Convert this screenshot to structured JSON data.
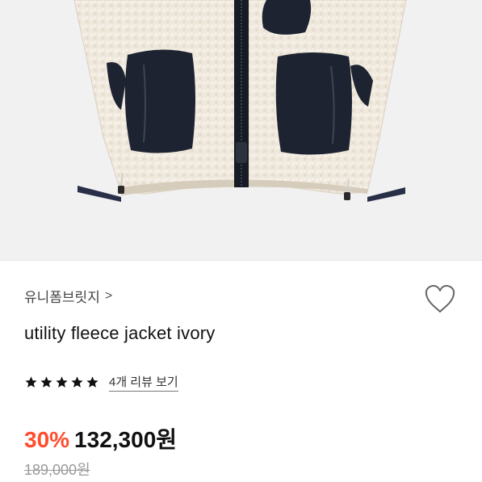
{
  "product": {
    "brand": "유니폼브릿지",
    "brand_chevron": ">",
    "title": "utility fleece jacket ivory",
    "rating_stars": 5,
    "review_link": "4개 리뷰 보기",
    "discount": "30%",
    "price": "132,300원",
    "original_price": "189,000원"
  },
  "colors": {
    "discount": "#ff4d2e",
    "fleece": "#efe8dc",
    "pocket": "#1d2330",
    "hero_bg": "#f1f1f1"
  },
  "icons": {
    "wishlist": "heart-outline-icon",
    "rating": "star-icon",
    "brand_nav": "chevron-right-icon"
  }
}
